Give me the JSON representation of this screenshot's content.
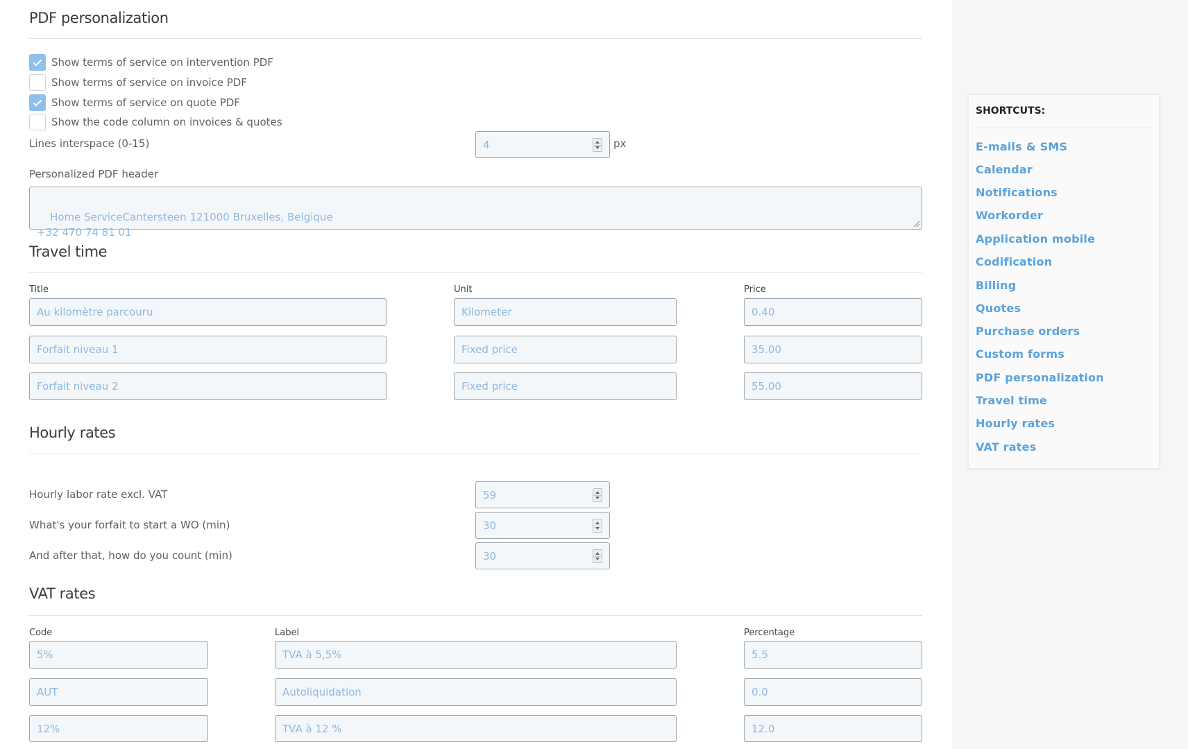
{
  "pdf": {
    "title": "PDF personalization",
    "checkboxes": [
      {
        "label": "Show terms of service on intervention PDF",
        "checked": true
      },
      {
        "label": "Show terms of service on invoice PDF",
        "checked": false
      },
      {
        "label": "Show terms of service on quote PDF",
        "checked": true
      },
      {
        "label": "Show the code column on invoices & quotes",
        "checked": false
      }
    ],
    "interspace_label": "Lines interspace (0-15)",
    "interspace_value": "4",
    "interspace_unit": "px",
    "header_label": "Personalized PDF header",
    "header_value": "Home ServiceCantersteen 121000 Bruxelles, Belgique\n+32 470 74 81 01"
  },
  "travel": {
    "title": "Travel time",
    "col_title": "Title",
    "col_unit": "Unit",
    "col_price": "Price",
    "rows": [
      {
        "title": "Au kilomètre parcouru",
        "unit": "Kilometer",
        "price": "0.40"
      },
      {
        "title": "Forfait niveau 1",
        "unit": "Fixed price",
        "price": "35.00"
      },
      {
        "title": "Forfait niveau 2",
        "unit": "Fixed price",
        "price": "55.00"
      }
    ]
  },
  "hourly": {
    "title": "Hourly rates",
    "rows": [
      {
        "label": "Hourly labor rate excl. VAT",
        "value": "59"
      },
      {
        "label": "What's your forfait to start a WO (min)",
        "value": "30"
      },
      {
        "label": "And after that, how do you count (min)",
        "value": "30"
      }
    ]
  },
  "vat": {
    "title": "VAT rates",
    "col_code": "Code",
    "col_label": "Label",
    "col_percentage": "Percentage",
    "rows": [
      {
        "code": "5%",
        "label": "TVA à 5,5%",
        "percentage": "5.5"
      },
      {
        "code": "AUT",
        "label": "Autoliquidation",
        "percentage": "0.0"
      },
      {
        "code": "12%",
        "label": "TVA à 12 %",
        "percentage": "12.0"
      }
    ]
  },
  "shortcuts": {
    "title": "SHORTCUTS:",
    "links": [
      "E-mails & SMS",
      "Calendar",
      "Notifications",
      "Workorder",
      "Application mobile",
      "Codification",
      "Billing",
      "Quotes",
      "Purchase orders",
      "Custom forms",
      "PDF personalization",
      "Travel time",
      "Hourly rates",
      "VAT rates"
    ]
  },
  "colors": {
    "link": "#5aa3dc",
    "checkbox_checked": "#8fc0ea",
    "field_text": "#8fb8e0",
    "field_bg": "#f3f7fa",
    "sidebar_bg": "#f6f6f6"
  }
}
